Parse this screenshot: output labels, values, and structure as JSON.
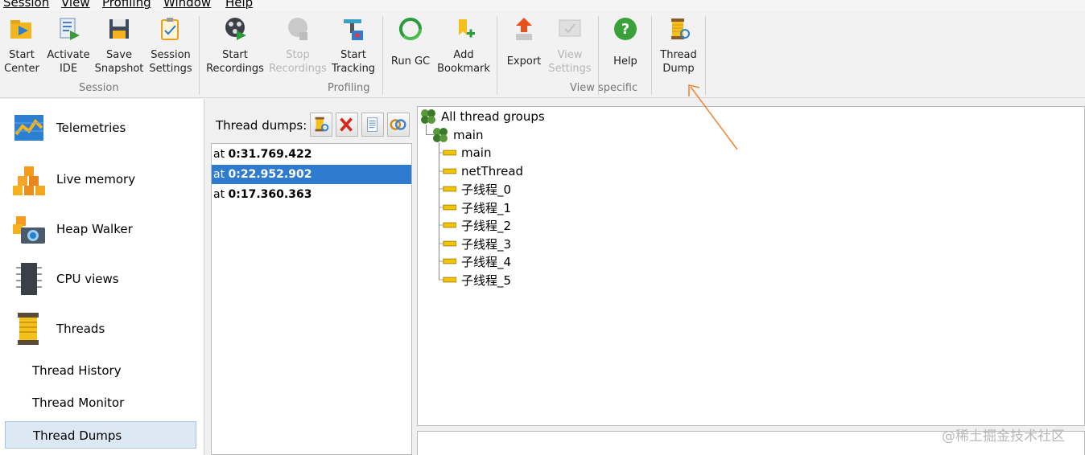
{
  "menu": [
    "Session",
    "View",
    "Profiling",
    "Window",
    "Help"
  ],
  "toolbar": {
    "buttons": [
      {
        "label": "Start\nCenter",
        "icon": "start-center-icon"
      },
      {
        "label": "Activate\nIDE",
        "icon": "activate-ide-icon"
      },
      {
        "label": "Save\nSnapshot",
        "icon": "save-snapshot-icon"
      },
      {
        "label": "Session\nSettings",
        "icon": "session-settings-icon"
      },
      {
        "label": "Start\nRecordings",
        "icon": "start-recordings-icon"
      },
      {
        "label": "Stop\nRecordings",
        "icon": "stop-recordings-icon",
        "disabled": true
      },
      {
        "label": "Start\nTracking",
        "icon": "start-tracking-icon"
      },
      {
        "label": "Run GC",
        "icon": "run-gc-icon"
      },
      {
        "label": "Add\nBookmark",
        "icon": "add-bookmark-icon"
      },
      {
        "label": "Export",
        "icon": "export-icon"
      },
      {
        "label": "View\nSettings",
        "icon": "view-settings-icon",
        "disabled": true
      },
      {
        "label": "Help",
        "icon": "help-icon"
      },
      {
        "label": "Thread\nDump",
        "icon": "thread-dump-icon"
      }
    ],
    "groups": [
      "Session",
      "Profiling",
      "View specific"
    ]
  },
  "nav": {
    "items": [
      {
        "label": "Telemetries",
        "icon": "telemetries-icon"
      },
      {
        "label": "Live memory",
        "icon": "live-memory-icon"
      },
      {
        "label": "Heap Walker",
        "icon": "heap-walker-icon"
      },
      {
        "label": "CPU views",
        "icon": "cpu-views-icon"
      },
      {
        "label": "Threads",
        "icon": "threads-icon"
      }
    ],
    "sub_items": [
      {
        "label": "Thread History"
      },
      {
        "label": "Thread Monitor"
      },
      {
        "label": "Thread Dumps",
        "selected": true
      }
    ]
  },
  "dumps": {
    "title": "Thread dumps:",
    "prefix": "at",
    "items": [
      {
        "time": "0:31.769.422"
      },
      {
        "time": "0:22.952.902",
        "selected": true
      },
      {
        "time": "0:17.360.363"
      }
    ]
  },
  "tree": {
    "root": "All thread groups",
    "group": "main",
    "threads": [
      "main",
      "netThread",
      "子线程_0",
      "子线程_1",
      "子线程_2",
      "子线程_3",
      "子线程_4",
      "子线程_5"
    ]
  },
  "watermark": "@稀土掘金技术社区",
  "colors": {
    "selection": "#2f7bd0",
    "thread_bar": "#f5c400",
    "accent_arrow": "#f0883a"
  }
}
